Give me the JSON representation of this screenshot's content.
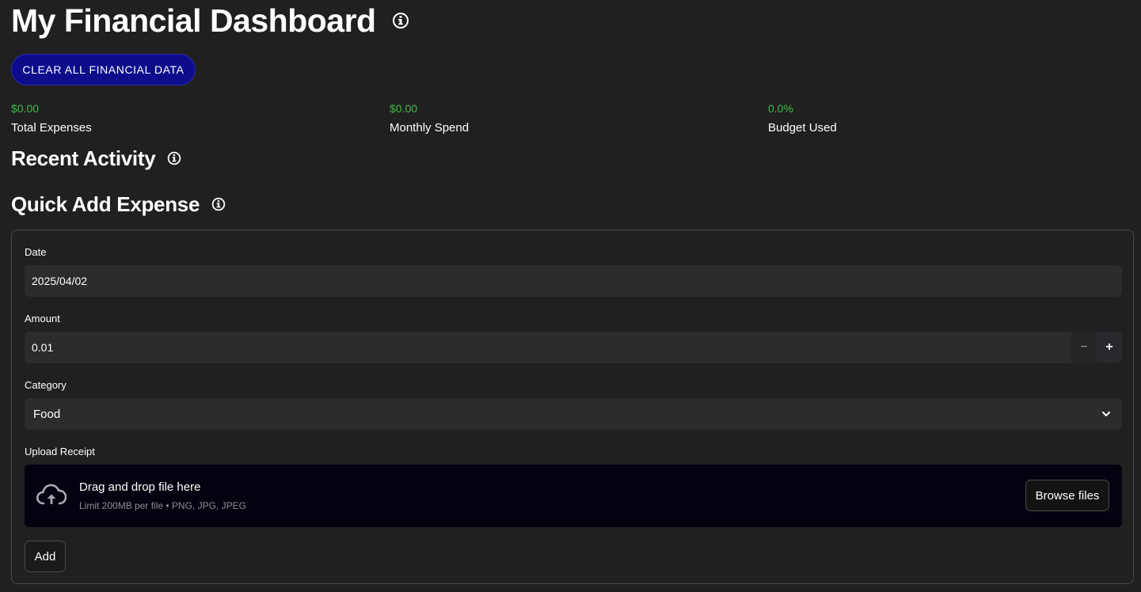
{
  "page": {
    "title": "My Financial Dashboard",
    "clear_button_label": "CLEAR ALL FINANCIAL DATA"
  },
  "metrics": [
    {
      "value": "$0.00",
      "label": "Total Expenses"
    },
    {
      "value": "$0.00",
      "label": "Monthly Spend"
    },
    {
      "value": "0.0%",
      "label": "Budget Used"
    }
  ],
  "sections": {
    "recent_activity": "Recent Activity",
    "quick_add": "Quick Add Expense"
  },
  "form": {
    "date": {
      "label": "Date",
      "value": "2025/04/02"
    },
    "amount": {
      "label": "Amount",
      "value": "0.01",
      "minus": "−",
      "plus": "+"
    },
    "category": {
      "label": "Category",
      "selected": "Food"
    },
    "upload": {
      "label": "Upload Receipt",
      "title": "Drag and drop file here",
      "subtitle": "Limit 200MB per file • PNG, JPG, JPEG",
      "browse_label": "Browse files"
    },
    "add_label": "Add"
  },
  "colors": {
    "background": "#202020",
    "metric_value": "#3dbb4a",
    "primary_button": "#0d0d8c",
    "dropzone": "#03020f"
  },
  "icons": {
    "info": "info-icon",
    "chevron": "chevron-down-icon",
    "upload": "cloud-upload-icon"
  }
}
